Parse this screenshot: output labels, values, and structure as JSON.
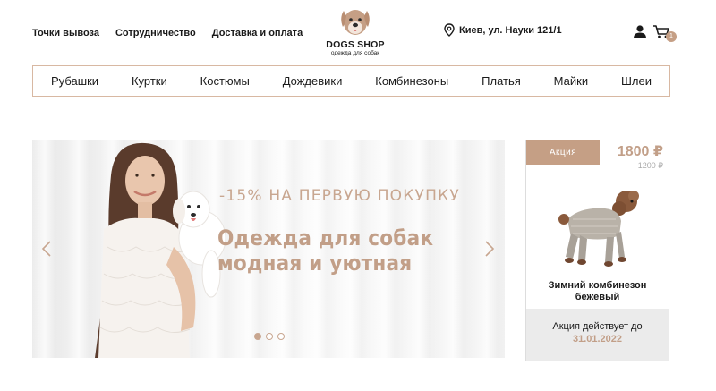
{
  "header": {
    "nav": [
      "Точки вывоза",
      "Сотрудничество",
      "Доставка и оплата"
    ],
    "logo": {
      "name": "DOGS SHOP",
      "tagline": "одежда для собак"
    },
    "address": "Киев, ул. Науки 121/1",
    "cart_count": "1"
  },
  "categories": [
    "Рубашки",
    "Куртки",
    "Костюмы",
    "Дождевики",
    "Комбинезоны",
    "Платья",
    "Майки",
    "Шлеи"
  ],
  "banner": {
    "subtitle": "-15% НА ПЕРВУЮ ПОКУПКУ",
    "title": "Одежда для собак модная и уютная",
    "slides": 3,
    "active_slide": 1
  },
  "promo_card": {
    "badge": "Акция",
    "price": "1800 ₽",
    "old_price": "1200 ₽",
    "product_name": "Зимний комбинезон бежевый",
    "valid_label": "Акция действует до",
    "valid_date": "31.01.2022"
  },
  "colors": {
    "accent": "#c59f85",
    "accent_text": "#c29f88",
    "border": "#d8b8a2",
    "card_footer_bg": "#ebebeb"
  },
  "icons": [
    "location-pin-icon",
    "user-icon",
    "cart-icon",
    "chevron-left-icon",
    "chevron-right-icon",
    "dog-logo-icon"
  ]
}
